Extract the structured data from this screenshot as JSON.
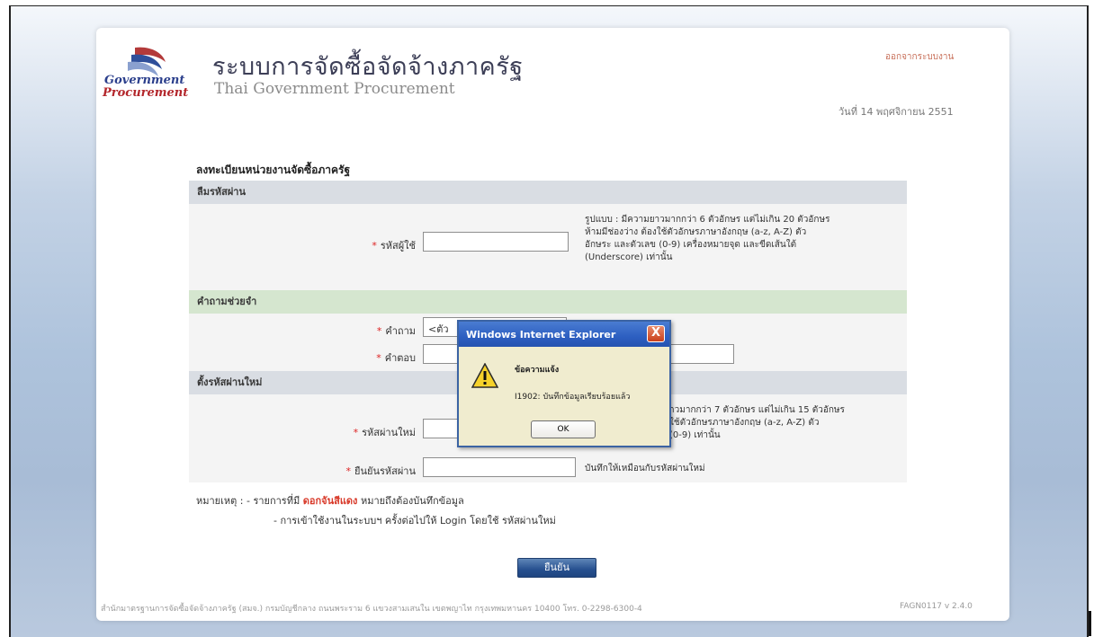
{
  "header": {
    "logo_line1": "Government",
    "logo_line2": "Procurement",
    "title_th": "ระบบการจัดซื้อจัดจ้างภาครัฐ",
    "title_en": "Thai Government Procurement",
    "logout": "ออกจากระบบงาน",
    "date": "วันที่ 14 พฤศจิกายน 2551"
  },
  "form": {
    "title": "ลงทะเบียนหน่วยงานจัดซื้อภาครัฐ",
    "section1": "ลืมรหัสผ่าน",
    "username_label": "รหัสผู้ใช้",
    "username_value": "",
    "username_hint": [
      "รูปแบบ : มีความยาวมากกว่า 6 ตัวอักษร แต่ไม่เกิน 20 ตัวอักษร",
      "ห้ามมีช่องว่าง ต้องใช้ตัวอักษรภาษาอังกฤษ (a-z, A-Z) ตัว",
      "อักษระ และตัวเลข (0-9) เครื่องหมายจุด และขีดเส้นใต้",
      "(Underscore) เท่านั้น"
    ],
    "section2": "คำถามช่วยจำ",
    "question_label": "คำถาม",
    "question_value": "<ตัว",
    "answer_label": "คำตอบ",
    "answer_value": "",
    "section3": "ตั้งรหัสผ่านใหม่",
    "new_password_label": "รหัสผ่านใหม่",
    "new_password_value": "",
    "new_password_hint": [
      "าวมากกว่า 7 ตัวอักษร แต่ไม่เกิน 15 ตัวอักษร",
      "ใช้ตัวอักษรภาษาอังกฤษ (a-z, A-Z) ตัว",
      "(0-9) เท่านั้น"
    ],
    "confirm_label": "ยืนยันรหัสผ่าน",
    "confirm_value": "",
    "confirm_hint": "บันทึกให้เหมือนกับรหัสผ่านใหม่",
    "required_mark": "*",
    "note_prefix": "หมายเหตุ : - รายการที่มี",
    "note_red": "ดอกจันสีแดง",
    "note_suffix": "หมายถึงต้องบันทึกข้อมูล",
    "note_line2": "- การเข้าใช้งานในระบบฯ ครั้งต่อไปให้ Login โดยใช้ รหัสผ่านใหม่",
    "submit": "ยืนยัน"
  },
  "footer": {
    "text": "สำนักมาตรฐานการจัดซื้อจัดจ้างภาครัฐ (สมจ.) กรมบัญชีกลาง ถนนพระราม 6 แขวงสามเสนใน เขตพญาไท กรุงเทพมหานคร 10400 โทร. 0-2298-6300-4",
    "version": "FAGN0117 v 2.4.0"
  },
  "dialog": {
    "title": "Windows Internet Explorer",
    "close": "X",
    "heading": "ข้อความแจ้ง",
    "message": "I1902: บันทึกข้อมูลเรียบร้อยแล้ว",
    "ok": "OK",
    "icon": "warning-icon"
  },
  "colors": {
    "accent": "#27508f",
    "required": "#d22222",
    "section_gray": "#d9dde3",
    "section_green": "#d5e6cf",
    "dialog_title": "#2d5fc1"
  }
}
